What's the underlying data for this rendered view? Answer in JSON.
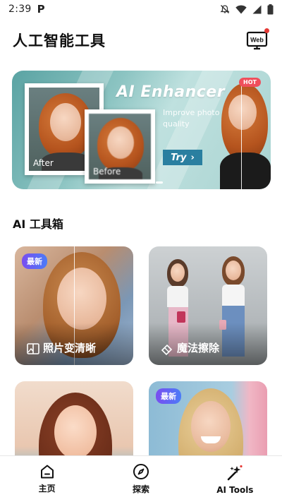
{
  "status_bar": {
    "time": "2:39",
    "app_indicator": "P"
  },
  "header": {
    "title": "人工智能工具",
    "web_button_label": "Web"
  },
  "banner": {
    "title": "AI Enhancer",
    "subtitle": "Improve photo quality",
    "try_label": "Try",
    "hot_label": "HOT",
    "after_label": "After",
    "before_label": "Before",
    "slides": 4,
    "active_slide": 4
  },
  "section": {
    "title": "AI 工具箱"
  },
  "tools": [
    {
      "label": "照片变清晰",
      "badge": "最新",
      "icon": "split-image-icon"
    },
    {
      "label": "魔法擦除",
      "badge": "",
      "icon": "eraser-icon"
    },
    {
      "label": "",
      "badge": "",
      "icon": ""
    },
    {
      "label": "",
      "badge": "最新",
      "icon": ""
    }
  ],
  "nav": {
    "items": [
      {
        "label": "主页",
        "icon": "home-icon"
      },
      {
        "label": "探索",
        "icon": "compass-icon"
      },
      {
        "label": "AI Tools",
        "icon": "magic-wand-icon"
      }
    ]
  },
  "colors": {
    "accent": "#2a7fa0",
    "hot": "#ef4f5c",
    "badge_gradient_start": "#7a4df0",
    "badge_gradient_end": "#4b7cf7"
  }
}
